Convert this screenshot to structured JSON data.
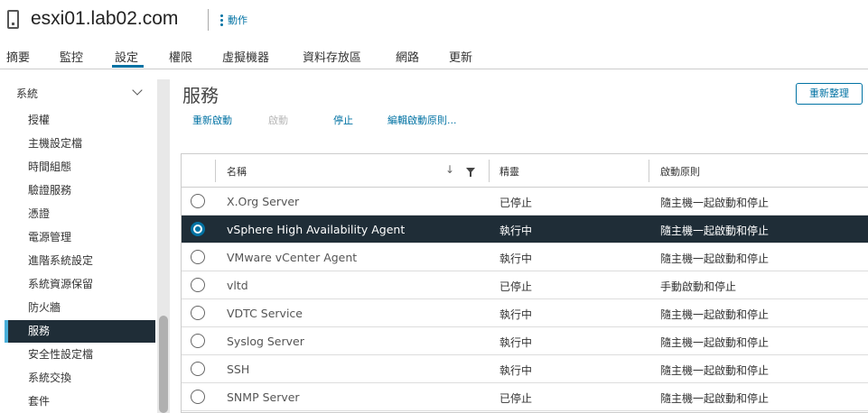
{
  "host": {
    "title": "esxi01.lab02.com",
    "actions_label": "動作"
  },
  "tabs": [
    {
      "label": "摘要"
    },
    {
      "label": "監控"
    },
    {
      "label": "設定"
    },
    {
      "label": "權限"
    },
    {
      "label": "虛擬機器"
    },
    {
      "label": "資料存放區"
    },
    {
      "label": "網路"
    },
    {
      "label": "更新"
    }
  ],
  "sidebar": {
    "section": "系統",
    "items": [
      {
        "label": "授權"
      },
      {
        "label": "主機設定檔"
      },
      {
        "label": "時間組態"
      },
      {
        "label": "驗證服務"
      },
      {
        "label": "憑證"
      },
      {
        "label": "電源管理"
      },
      {
        "label": "進階系統設定"
      },
      {
        "label": "系統資源保留"
      },
      {
        "label": "防火牆"
      },
      {
        "label": "服務"
      },
      {
        "label": "安全性設定檔"
      },
      {
        "label": "系統交換"
      },
      {
        "label": "套件"
      }
    ]
  },
  "main": {
    "title": "服務",
    "refresh_label": "重新整理",
    "toolbar": {
      "restart": "重新啟動",
      "start": "啟動",
      "stop": "停止",
      "edit_policy": "編輯啟動原則..."
    }
  },
  "table": {
    "columns": {
      "name": "名稱",
      "status": "精靈",
      "policy": "啟動原則"
    },
    "rows": [
      {
        "name": "X.Org Server",
        "status": "已停止",
        "policy": "隨主機一起啟動和停止"
      },
      {
        "name": "vSphere High Availability Agent",
        "status": "執行中",
        "policy": "隨主機一起啟動和停止"
      },
      {
        "name": "VMware vCenter Agent",
        "status": "執行中",
        "policy": "隨主機一起啟動和停止"
      },
      {
        "name": "vltd",
        "status": "已停止",
        "policy": "手動啟動和停止"
      },
      {
        "name": "VDTC Service",
        "status": "執行中",
        "policy": "隨主機一起啟動和停止"
      },
      {
        "name": "Syslog Server",
        "status": "執行中",
        "policy": "隨主機一起啟動和停止"
      },
      {
        "name": "SSH",
        "status": "執行中",
        "policy": "隨主機一起啟動和停止"
      },
      {
        "name": "SNMP Server",
        "status": "已停止",
        "policy": "隨主機一起啟動和停止"
      }
    ]
  },
  "colors": {
    "accent": "#0072a3",
    "selected_bg": "#1f2d37",
    "active_marker": "#49afd9"
  },
  "icons": {
    "host": "host-server-icon",
    "actions": "kebab-menu-icon",
    "section": "chevron-down-icon",
    "sort": "sort-arrow-icon",
    "filter": "filter-icon"
  }
}
